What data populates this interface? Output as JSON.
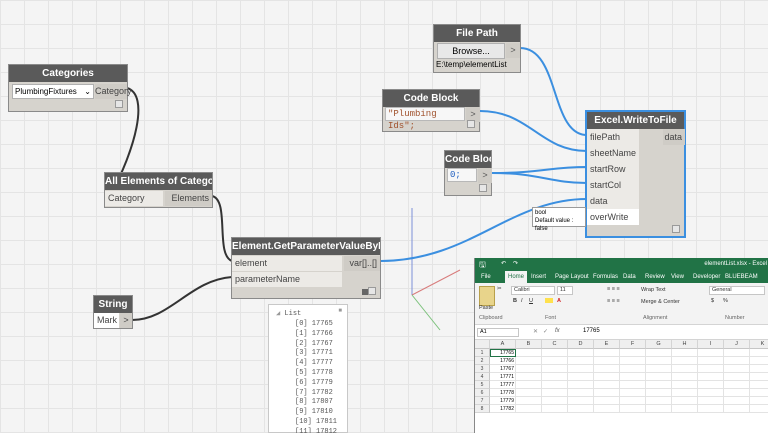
{
  "nodes": {
    "categories": {
      "title": "Categories",
      "dropdown_value": "PlumbingFixtures",
      "dropdown_arrow": "⌄",
      "out_port": "Category"
    },
    "all_elements": {
      "title": "All Elements of Category",
      "in_port": "Category",
      "out_port": "Elements"
    },
    "get_param": {
      "title": "Element.GetParameterValueByName",
      "in_ports": [
        "element",
        "parameterName"
      ],
      "out_port": "var[]..[]"
    },
    "string": {
      "title": "String",
      "value": "Mark",
      "out_arrow": ">"
    },
    "file_path": {
      "title": "File Path",
      "button": "Browse...",
      "out_arrow": ">",
      "path": "E:\\temp\\elementList"
    },
    "code_block_1": {
      "title": "Code Block",
      "code": "\"Plumbing Ids\";",
      "out_arrow": ">"
    },
    "code_block_2": {
      "title": "Code Block",
      "code": "0;",
      "out_arrow": ">"
    },
    "excel_write": {
      "title": "Excel.WriteToFile",
      "in_ports": [
        "filePath",
        "sheetName",
        "startRow",
        "startCol",
        "data",
        "overWrite"
      ],
      "out_port": "data"
    }
  },
  "tooltip": {
    "line1": "bool",
    "line2": "Default value : false"
  },
  "watch": {
    "header": "List",
    "pin": "■",
    "items": [
      "[0] 17765",
      "[1] 17766",
      "[2] 17767",
      "[3] 17771",
      "[4] 17777",
      "[5] 17778",
      "[6] 17779",
      "[7] 17782",
      "[8] 17807",
      "[9] 17810",
      "[10] 17811",
      "[11] 17812"
    ]
  },
  "excel": {
    "title": "elementList.xlsx - Excel",
    "tabs": [
      "File",
      "Home",
      "Insert",
      "Page Layout",
      "Formulas",
      "Data",
      "Review",
      "View",
      "Developer",
      "BLUEBEAM"
    ],
    "active_tab": "Home",
    "ribbon": {
      "paste": "Paste",
      "font_name": "Calibri",
      "font_size": "11",
      "bold": "B",
      "italic": "I",
      "underline": "U",
      "wrap_text": "Wrap Text",
      "merge_center": "Merge & Center",
      "number_format": "General",
      "currency": "$",
      "percent": "%",
      "groups": [
        "Clipboard",
        "Font",
        "Alignment",
        "Number"
      ]
    },
    "name_box": "A1",
    "fx": "fx",
    "formula_value": "17765",
    "columns": [
      "A",
      "B",
      "C",
      "D",
      "E",
      "F",
      "G",
      "H",
      "I",
      "J",
      "K"
    ],
    "rows": [
      "1",
      "2",
      "3",
      "4",
      "5",
      "6",
      "7",
      "8"
    ],
    "values": [
      "17765",
      "17766",
      "17767",
      "17771",
      "17777",
      "17778",
      "17779",
      "17782"
    ]
  },
  "colors": {
    "wire": "#3b8fe0",
    "wire_dark": "#333333",
    "node_header": "#5a5a5a",
    "excel_green": "#217346"
  }
}
